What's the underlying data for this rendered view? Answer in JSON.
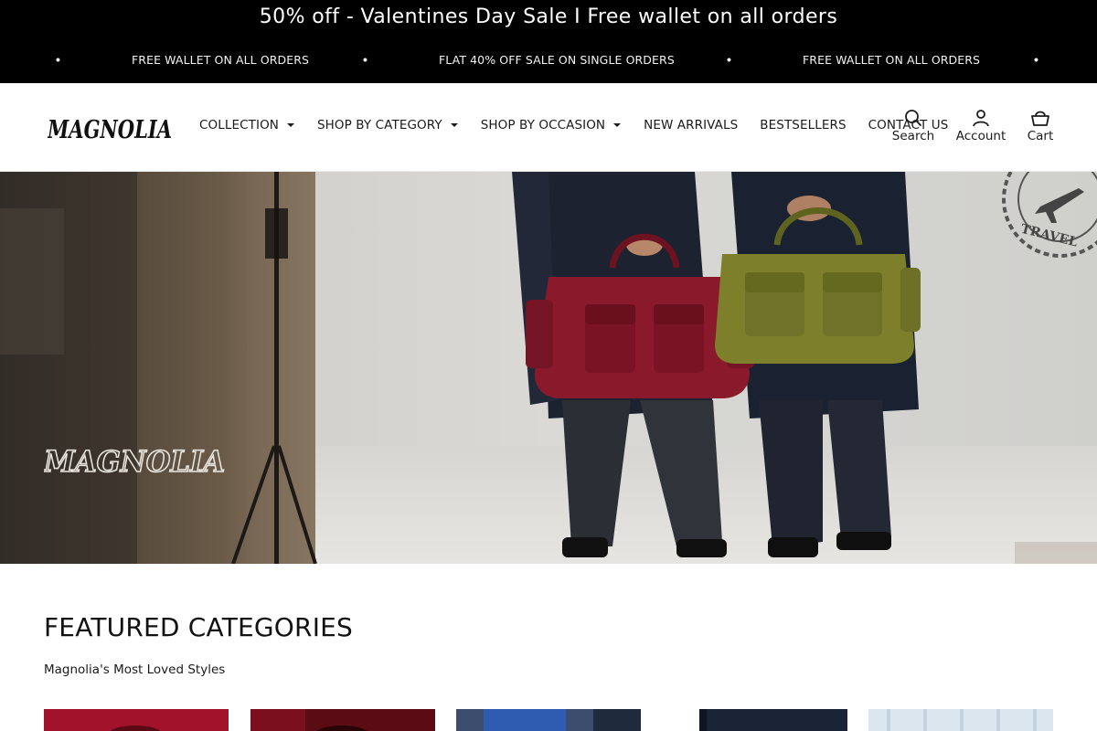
{
  "announcement": {
    "title": "50% off - Valentines Day Sale I Free wallet on all orders",
    "ticker": [
      "FREE WALLET ON ALL ORDERS",
      "FLAT 40% OFF SALE ON SINGLE ORDERS",
      "FREE WALLET ON ALL ORDERS"
    ]
  },
  "header": {
    "brand": "MAGNOLIA",
    "nav": [
      {
        "label": "COLLECTION",
        "has_dropdown": true
      },
      {
        "label": "SHOP BY CATEGORY",
        "has_dropdown": true
      },
      {
        "label": "SHOP BY OCCASION",
        "has_dropdown": true
      },
      {
        "label": "NEW ARRIVALS",
        "has_dropdown": false
      },
      {
        "label": "BESTSELLERS",
        "has_dropdown": false
      },
      {
        "label": "CONTACT US",
        "has_dropdown": false
      }
    ],
    "actions": {
      "search": {
        "label": "Search",
        "icon": "search-icon"
      },
      "account": {
        "label": "Account",
        "icon": "user-icon"
      },
      "cart": {
        "label": "Cart",
        "icon": "basket-icon"
      }
    }
  },
  "hero": {
    "brand_overlay": "MAGNOLIA",
    "stamp_text": "TRAVEL"
  },
  "featured": {
    "title": "FEATURED CATEGORIES",
    "subtitle": "Magnolia's Most Loved Styles",
    "cards": [
      {
        "name": "category-card-1",
        "color": "#a3122b"
      },
      {
        "name": "category-card-2",
        "color": "#5a0b14"
      },
      {
        "name": "category-card-3",
        "color": "#2f5bb0"
      },
      {
        "name": "category-card-4",
        "color": "#1b2436"
      },
      {
        "name": "category-card-5",
        "color": "#dce6ef"
      }
    ]
  },
  "colors": {
    "announce_bg": "#000000",
    "text": "#1a1a1a",
    "bag_maroon": "#8a1a2b",
    "bag_olive": "#7d7f2a"
  }
}
